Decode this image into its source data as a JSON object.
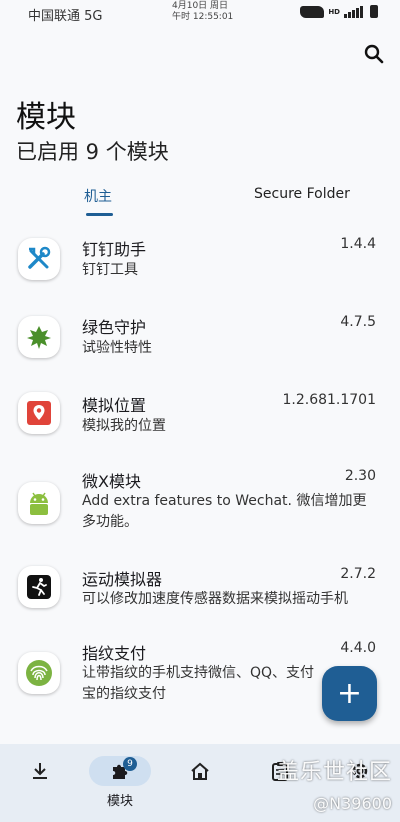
{
  "status_bar": {
    "carrier": "中国联通 5G",
    "date_line": "4月10日 周日",
    "time_line": "午时 12:55:01",
    "network": "HD"
  },
  "header": {
    "title": "模块",
    "subtitle": "已启用 9 个模块"
  },
  "tabs": [
    {
      "label": "机主",
      "active": true
    },
    {
      "label": "Secure Folder",
      "active": false
    }
  ],
  "modules": [
    {
      "name": "钉钉助手",
      "version": "1.4.4",
      "description": "钉钉工具",
      "icon": "tools-icon"
    },
    {
      "name": "绿色守护",
      "version": "4.7.5",
      "description": "试验性特性",
      "icon": "leaf-icon"
    },
    {
      "name": "模拟位置",
      "version": "1.2.681.1701",
      "description": "模拟我的位置",
      "icon": "location-pin-icon"
    },
    {
      "name": "微X模块",
      "version": "2.30",
      "description": "Add extra features to Wechat. 微信增加更多功能。",
      "icon": "android-icon"
    },
    {
      "name": "运动模拟器",
      "version": "2.7.2",
      "description": "可以修改加速度传感器数据来模拟摇动手机",
      "icon": "runner-icon"
    },
    {
      "name": "指纹支付",
      "version": "4.4.0",
      "description": "让带指纹的手机支持微信、QQ、支付宝的指纹支付",
      "icon": "fingerprint-icon"
    }
  ],
  "fab": {
    "label": "+"
  },
  "bottom_nav": {
    "items": [
      {
        "id": "download",
        "label": ""
      },
      {
        "id": "modules",
        "label": "模块",
        "badge": "9",
        "active": true
      },
      {
        "id": "home",
        "label": ""
      },
      {
        "id": "logs",
        "label": ""
      },
      {
        "id": "settings",
        "label": ""
      }
    ]
  },
  "watermark": {
    "line1": "盖乐世社区",
    "line2": "@N39600"
  },
  "colors": {
    "accent": "#1f5e94",
    "nav_background": "#e7edf4",
    "background": "#f8f9fb"
  }
}
